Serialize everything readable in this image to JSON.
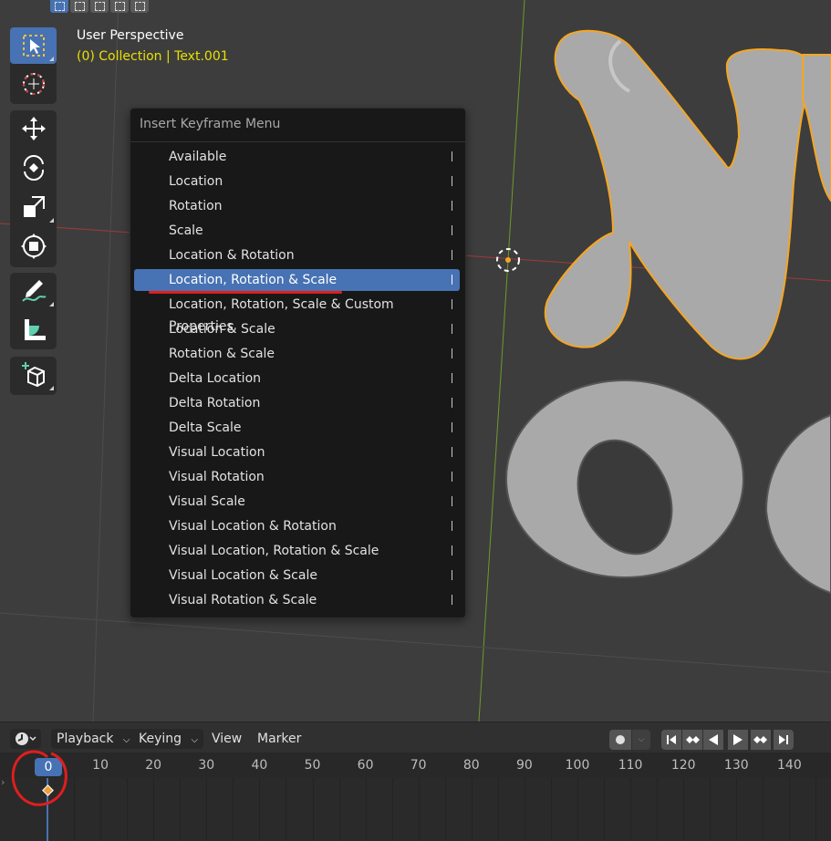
{
  "viewport": {
    "view_name": "User Perspective",
    "collection_info": "(0) Collection | Text.001"
  },
  "menu": {
    "title": "Insert Keyframe Menu",
    "items": [
      {
        "label": "Available"
      },
      {
        "label": "Location"
      },
      {
        "label": "Rotation"
      },
      {
        "label": "Scale"
      },
      {
        "label": "Location & Rotation"
      },
      {
        "label": "Location, Rotation & Scale",
        "highlighted": true
      },
      {
        "label": "Location, Rotation, Scale & Custom Properties"
      },
      {
        "label": "Location & Scale"
      },
      {
        "label": "Rotation & Scale"
      },
      {
        "label": "Delta Location"
      },
      {
        "label": "Delta Rotation"
      },
      {
        "label": "Delta Scale"
      },
      {
        "label": "Visual Location"
      },
      {
        "label": "Visual Rotation"
      },
      {
        "label": "Visual Scale"
      },
      {
        "label": "Visual Location & Rotation"
      },
      {
        "label": "Visual Location, Rotation & Scale"
      },
      {
        "label": "Visual Location & Scale"
      },
      {
        "label": "Visual Rotation & Scale"
      }
    ]
  },
  "timeline": {
    "playback_label": "Playback",
    "keying_label": "Keying",
    "view_label": "View",
    "marker_label": "Marker",
    "current_frame": "0",
    "frame_numbers": [
      "10",
      "20",
      "30",
      "40",
      "50",
      "60",
      "70",
      "80",
      "90",
      "100",
      "110",
      "120",
      "130",
      "140"
    ]
  },
  "colors": {
    "accent": "#4772b3",
    "selection_outline": "#f5a623",
    "annotation_red": "#e01e1e",
    "viewport_bg": "#3d3d3d"
  }
}
